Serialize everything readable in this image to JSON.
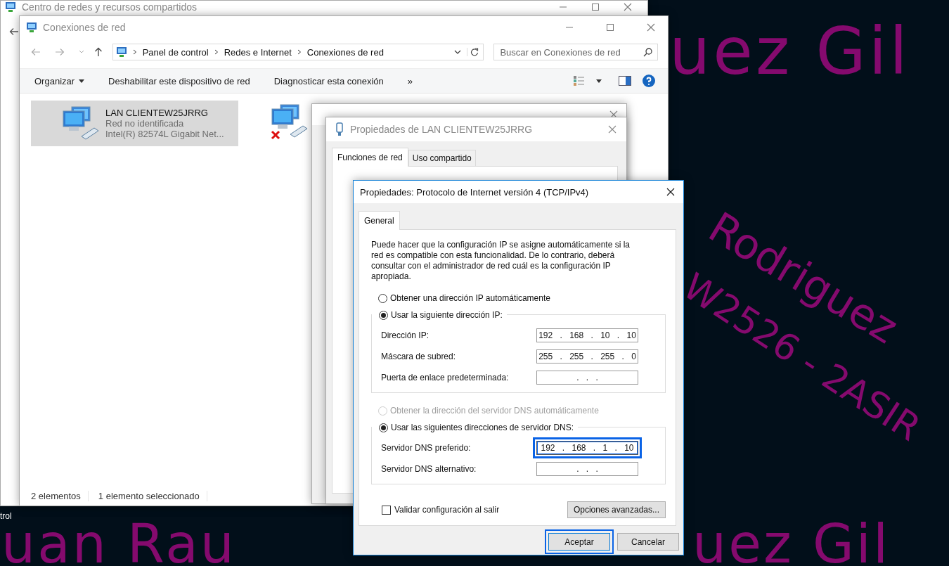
{
  "desktop": {
    "wallpaper_texts": [
      {
        "text": "uez Gil",
        "kind": "top"
      },
      {
        "text": "Rodriguez",
        "kind": "diagonal-upper"
      },
      {
        "text": "W2526 - 2ASIR",
        "kind": "diagonal-lower"
      },
      {
        "text": "uan Rau",
        "kind": "bottom-left"
      },
      {
        "text": "uez Gil",
        "kind": "bottom-right"
      }
    ],
    "icon_label": "trol"
  },
  "back_window": {
    "title": "Centro de redes y recursos compartidos"
  },
  "explorer": {
    "title": "Conexiones de red",
    "breadcrumb": [
      "Panel de control",
      "Redes e Internet",
      "Conexiones de red"
    ],
    "search": {
      "placeholder": "Buscar en Conexiones de red"
    },
    "toolbar": [
      {
        "label": "Organizar",
        "kind": "menu"
      },
      {
        "label": "Deshabilitar este dispositivo de red",
        "kind": "command"
      },
      {
        "label": "Diagnosticar esta conexión",
        "kind": "command"
      },
      {
        "label": "»",
        "kind": "overflow"
      }
    ],
    "connections": [
      {
        "name": "LAN CLIENTEW25JRRG",
        "status": "Red no identificada",
        "adapter": "Intel(R) 82574L Gigabit Net...",
        "selected": true,
        "connected": true
      },
      {
        "selected": false,
        "connected": false
      }
    ],
    "status_bar": [
      "2 elementos",
      "1 elemento seleccionado"
    ]
  },
  "lan_properties": {
    "title": "Propiedades de LAN CLIENTEW25JRRG",
    "tabs": [
      {
        "label": "Funciones de red",
        "selected": true
      },
      {
        "label": "Uso compartido",
        "selected": false
      }
    ]
  },
  "ipv4_dialog": {
    "title": "Propiedades: Protocolo de Internet versión 4 (TCP/IPv4)",
    "active": true,
    "tabs": [
      {
        "label": "General",
        "selected": true
      }
    ],
    "description": "Puede hacer que la configuración IP se asigne automáticamente si la red es compatible con esta funcionalidad. De lo contrario, deberá consultar con el administrador de red cuál es la configuración IP apropiada.",
    "ip_mode": [
      {
        "label": "Obtener una dirección IP automáticamente",
        "selected": false,
        "disabled": false
      },
      {
        "label": "Usar la siguiente dirección IP:",
        "selected": true,
        "disabled": false
      }
    ],
    "ip_fields": [
      {
        "label": "Dirección IP:",
        "value": "192 . 168 . 10 . 10",
        "focused": false
      },
      {
        "label": "Máscara de subred:",
        "value": "255 . 255 . 255 . 0",
        "focused": false
      },
      {
        "label": "Puerta de enlace predeterminada:",
        "value": ". . .",
        "focused": false
      }
    ],
    "dns_mode": [
      {
        "label": "Obtener la dirección del servidor DNS automáticamente",
        "selected": false,
        "disabled": true
      },
      {
        "label": "Usar las siguientes direcciones de servidor DNS:",
        "selected": true,
        "disabled": false
      }
    ],
    "dns_fields": [
      {
        "label": "Servidor DNS preferido:",
        "value": "192 . 168 . 1 . 10",
        "focused": true
      },
      {
        "label": "Servidor DNS alternativo:",
        "value": ". . .",
        "focused": false
      }
    ],
    "validate": {
      "label": "Validar configuración al salir",
      "checked": false
    },
    "advanced_button": "Opciones avanzadas...",
    "buttons": [
      {
        "label": "Aceptar",
        "default": true
      },
      {
        "label": "Cancelar",
        "default": false
      }
    ]
  }
}
